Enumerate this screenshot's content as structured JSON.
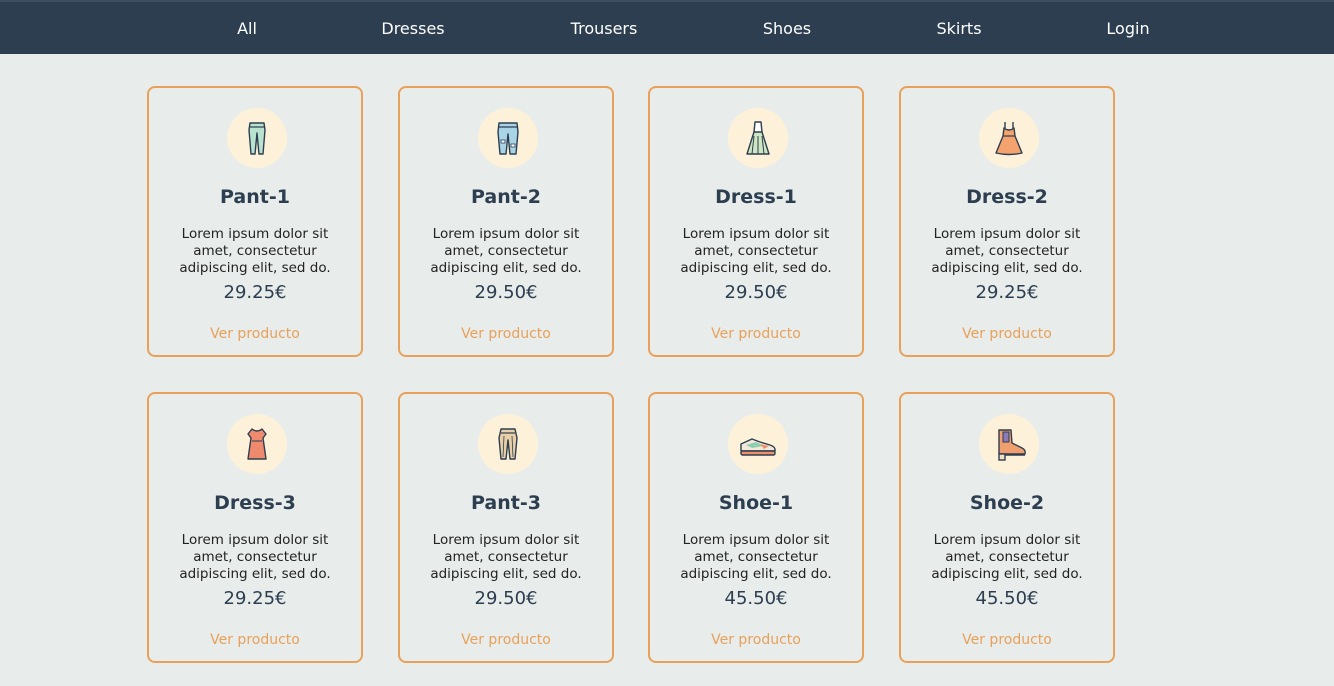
{
  "nav": {
    "items": [
      {
        "label": "All"
      },
      {
        "label": "Dresses"
      },
      {
        "label": "Trousers"
      },
      {
        "label": "Shoes"
      },
      {
        "label": "Skirts"
      },
      {
        "label": "Login"
      }
    ]
  },
  "colors": {
    "nav_bg": "#2c3e50",
    "page_bg": "#e8ecea",
    "accent": "#e8a15a",
    "icon_bg": "#fdf2d9",
    "title": "#2c3e50"
  },
  "products": [
    {
      "icon": "leggings-icon",
      "name": "Pant-1",
      "description": "Lorem ipsum dolor sit amet, consectetur adipiscing elit, sed do.",
      "price": "29.25€",
      "link": "Ver producto"
    },
    {
      "icon": "jeans-icon",
      "name": "Pant-2",
      "description": "Lorem ipsum dolor sit amet, consectetur adipiscing elit, sed do.",
      "price": "29.50€",
      "link": "Ver producto"
    },
    {
      "icon": "dress-icon",
      "name": "Dress-1",
      "description": "Lorem ipsum dolor sit amet, consectetur adipiscing elit, sed do.",
      "price": "29.50€",
      "link": "Ver producto"
    },
    {
      "icon": "dress-icon",
      "name": "Dress-2",
      "description": "Lorem ipsum dolor sit amet, consectetur adipiscing elit, sed do.",
      "price": "29.25€",
      "link": "Ver producto"
    },
    {
      "icon": "dress-icon",
      "name": "Dress-3",
      "description": "Lorem ipsum dolor sit amet, consectetur adipiscing elit, sed do.",
      "price": "29.25€",
      "link": "Ver producto"
    },
    {
      "icon": "trousers-icon",
      "name": "Pant-3",
      "description": "Lorem ipsum dolor sit amet, consectetur adipiscing elit, sed do.",
      "price": "29.50€",
      "link": "Ver producto"
    },
    {
      "icon": "sneaker-icon",
      "name": "Shoe-1",
      "description": "Lorem ipsum dolor sit amet, consectetur adipiscing elit, sed do.",
      "price": "45.50€",
      "link": "Ver producto"
    },
    {
      "icon": "boot-icon",
      "name": "Shoe-2",
      "description": "Lorem ipsum dolor sit amet, consectetur adipiscing elit, sed do.",
      "price": "45.50€",
      "link": "Ver producto"
    }
  ]
}
